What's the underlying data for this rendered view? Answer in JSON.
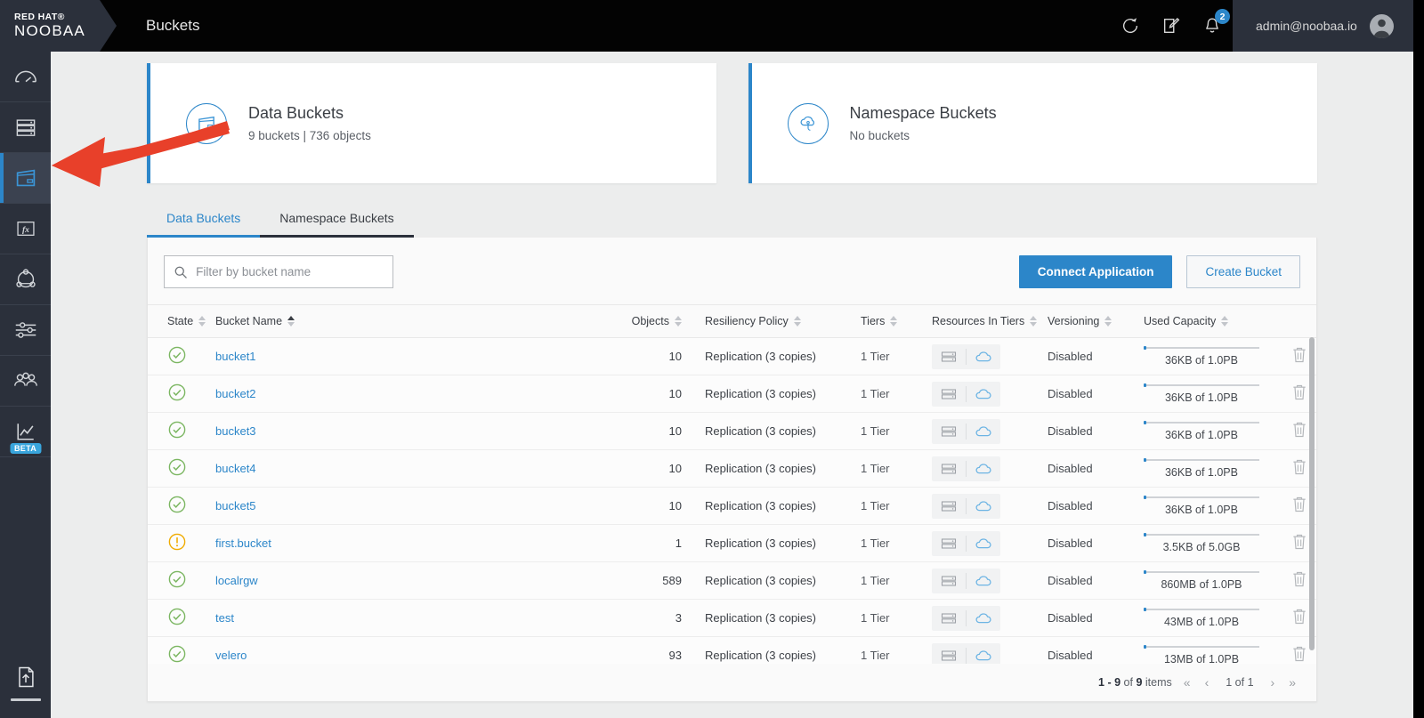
{
  "topbar": {
    "logo_line1": "RED HAT®",
    "logo_line2": "NOOBAA",
    "title": "Buckets",
    "refresh_icon": "refresh-icon",
    "edit_icon": "edit-note-icon",
    "bell_icon": "bell-icon",
    "notification_count": "2",
    "user_email": "admin@noobaa.io"
  },
  "sidebar": {
    "items": [
      {
        "name": "overview",
        "icon": "gauge-icon",
        "active": false
      },
      {
        "name": "resources",
        "icon": "server-stack-icon",
        "active": false
      },
      {
        "name": "buckets",
        "icon": "bucket-icon",
        "active": true
      },
      {
        "name": "functions",
        "icon": "fx-icon",
        "active": false
      },
      {
        "name": "namespace",
        "icon": "topology-icon",
        "active": false
      },
      {
        "name": "settings",
        "icon": "sliders-icon",
        "active": false
      },
      {
        "name": "accounts",
        "icon": "users-icon",
        "active": false
      },
      {
        "name": "analytics",
        "icon": "chart-line-icon",
        "active": false,
        "badge": "BETA"
      }
    ],
    "bottom": {
      "name": "upload-files",
      "icon": "file-upload-icon"
    }
  },
  "cards": [
    {
      "icon": "bucket-icon",
      "title": "Data Buckets",
      "subtitle": "9 buckets | 736 objects"
    },
    {
      "icon": "namespace-cloud-icon",
      "title": "Namespace Buckets",
      "subtitle": "No buckets"
    }
  ],
  "tabs": [
    {
      "label": "Data Buckets",
      "active": true
    },
    {
      "label": "Namespace Buckets",
      "active": false
    }
  ],
  "toolbar": {
    "search_placeholder": "Filter by bucket name",
    "search_value": "",
    "search_icon": "search-icon",
    "connect_application_label": "Connect Application",
    "create_bucket_label": "Create Bucket"
  },
  "table": {
    "columns": [
      {
        "label": "State",
        "sort": "none"
      },
      {
        "label": "Bucket Name",
        "sort": "asc"
      },
      {
        "label": "Objects",
        "sort": "none"
      },
      {
        "label": "Resiliency Policy",
        "sort": "none"
      },
      {
        "label": "Tiers",
        "sort": "none"
      },
      {
        "label": "Resources In Tiers",
        "sort": "none"
      },
      {
        "label": "Versioning",
        "sort": "none"
      },
      {
        "label": "Used Capacity",
        "sort": "none"
      }
    ],
    "rows": [
      {
        "state": "healthy",
        "name": "bucket1",
        "objects": "10",
        "policy": "Replication (3 copies)",
        "tiers": "1 Tier",
        "resources": [
          "server-icon",
          "cloud-icon"
        ],
        "versioning": "Disabled",
        "capacity_text": "36KB of 1.0PB",
        "capacity_pct": 1
      },
      {
        "state": "healthy",
        "name": "bucket2",
        "objects": "10",
        "policy": "Replication (3 copies)",
        "tiers": "1 Tier",
        "resources": [
          "server-icon",
          "cloud-icon"
        ],
        "versioning": "Disabled",
        "capacity_text": "36KB of 1.0PB",
        "capacity_pct": 1
      },
      {
        "state": "healthy",
        "name": "bucket3",
        "objects": "10",
        "policy": "Replication (3 copies)",
        "tiers": "1 Tier",
        "resources": [
          "server-icon",
          "cloud-icon"
        ],
        "versioning": "Disabled",
        "capacity_text": "36KB of 1.0PB",
        "capacity_pct": 1
      },
      {
        "state": "healthy",
        "name": "bucket4",
        "objects": "10",
        "policy": "Replication (3 copies)",
        "tiers": "1 Tier",
        "resources": [
          "server-icon",
          "cloud-icon"
        ],
        "versioning": "Disabled",
        "capacity_text": "36KB of 1.0PB",
        "capacity_pct": 1
      },
      {
        "state": "healthy",
        "name": "bucket5",
        "objects": "10",
        "policy": "Replication (3 copies)",
        "tiers": "1 Tier",
        "resources": [
          "server-icon",
          "cloud-icon"
        ],
        "versioning": "Disabled",
        "capacity_text": "36KB of 1.0PB",
        "capacity_pct": 1
      },
      {
        "state": "warning",
        "name": "first.bucket",
        "objects": "1",
        "policy": "Replication (3 copies)",
        "tiers": "1 Tier",
        "resources": [
          "server-icon",
          "cloud-icon"
        ],
        "versioning": "Disabled",
        "capacity_text": "3.5KB of 5.0GB",
        "capacity_pct": 1
      },
      {
        "state": "healthy",
        "name": "localrgw",
        "objects": "589",
        "policy": "Replication (3 copies)",
        "tiers": "1 Tier",
        "resources": [
          "server-icon",
          "cloud-icon"
        ],
        "versioning": "Disabled",
        "capacity_text": "860MB of 1.0PB",
        "capacity_pct": 1
      },
      {
        "state": "healthy",
        "name": "test",
        "objects": "3",
        "policy": "Replication (3 copies)",
        "tiers": "1 Tier",
        "resources": [
          "server-icon",
          "cloud-icon"
        ],
        "versioning": "Disabled",
        "capacity_text": "43MB of 1.0PB",
        "capacity_pct": 1
      },
      {
        "state": "healthy",
        "name": "velero",
        "objects": "93",
        "policy": "Replication (3 copies)",
        "tiers": "1 Tier",
        "resources": [
          "server-icon",
          "cloud-icon"
        ],
        "versioning": "Disabled",
        "capacity_text": "13MB of 1.0PB",
        "capacity_pct": 1
      }
    ],
    "delete_icon": "trash-icon"
  },
  "pagination": {
    "range_start": "1 - 9",
    "of_label": "of",
    "total": "9",
    "items_label": "items",
    "first_icon": "«",
    "prev_icon": "‹",
    "page_label": "1 of 1",
    "next_icon": "›",
    "last_icon": "»"
  },
  "annotation": {
    "arrow_color": "#e8402a",
    "points_to": "sidebar-item-buckets"
  },
  "colors": {
    "accent": "#2c86c9",
    "sidebar_bg": "#2b303b",
    "topbar_bg": "#030303",
    "healthy": "#7bb661",
    "warning": "#f0ab00",
    "page_bg": "#eceded"
  }
}
